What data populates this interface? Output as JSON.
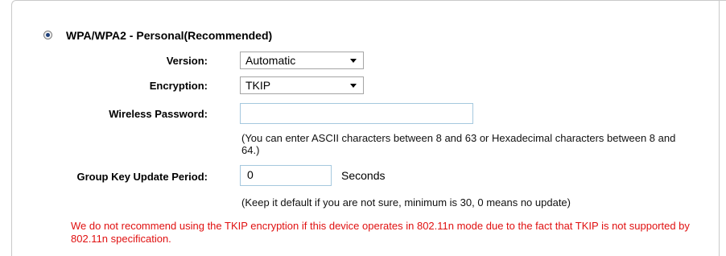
{
  "security_mode": {
    "title": "WPA/WPA2 - Personal(Recommended)",
    "selected": true
  },
  "version": {
    "label": "Version:",
    "value": "Automatic"
  },
  "encryption": {
    "label": "Encryption:",
    "value": "TKIP"
  },
  "password": {
    "label": "Wireless Password:",
    "value": "",
    "hint": "(You can enter ASCII characters between 8 and 63 or Hexadecimal characters between 8 and 64.)"
  },
  "group_key": {
    "label": "Group Key Update Period:",
    "value": "0",
    "unit": "Seconds",
    "hint": "(Keep it default if you are not sure, minimum is 30, 0 means no update)"
  },
  "warning": "We do not recommend using the TKIP encryption if this device operates in 802.11n mode due to the fact that TKIP is not supported by 802.11n specification.",
  "colors": {
    "warning": "#e01010",
    "input_border": "#a5c8de",
    "frame": "#c9c9c9"
  }
}
